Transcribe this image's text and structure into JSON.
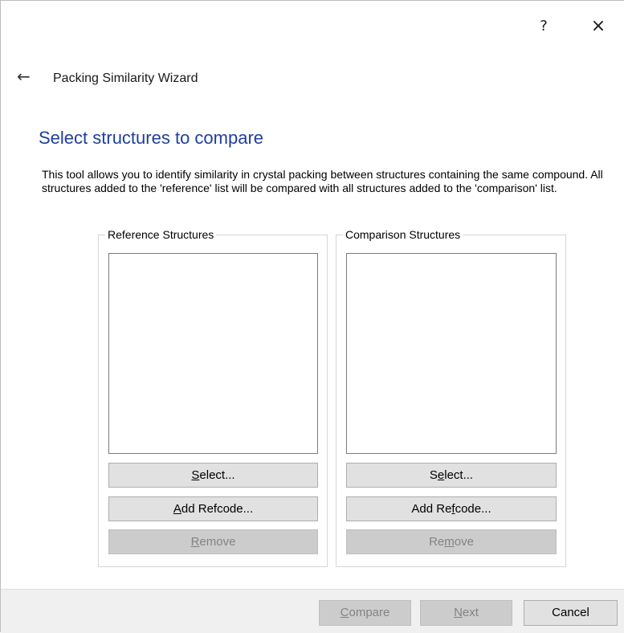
{
  "titlebar": {
    "help_label": "?",
    "close_label": "×",
    "icons": {
      "help": "question-mark-icon",
      "close": "close-icon"
    }
  },
  "header": {
    "back_icon": "←",
    "window_title": "Packing Similarity Wizard"
  },
  "page": {
    "heading": "Select structures to compare",
    "description": "This tool allows you to identify similarity in crystal packing between structures containing the same compound. All structures added to the 'reference' list will be compared with all structures added to the 'comparison' list."
  },
  "reference": {
    "title": "Reference Structures",
    "items": [],
    "select": {
      "before": "",
      "key": "S",
      "after": "elect..."
    },
    "add_refcode": {
      "before": "",
      "key": "A",
      "after": "dd Refcode..."
    },
    "remove": {
      "before": "",
      "key": "R",
      "after": "emove"
    }
  },
  "comparison": {
    "title": "Comparison Structures",
    "items": [],
    "select": {
      "before": "S",
      "key": "e",
      "after": "lect..."
    },
    "add_refcode": {
      "before": "Add Re",
      "key": "f",
      "after": "code..."
    },
    "remove": {
      "before": "Re",
      "key": "m",
      "after": "ove"
    }
  },
  "footer": {
    "compare": {
      "before": "",
      "key": "C",
      "after": "ompare"
    },
    "next": {
      "before": "",
      "key": "N",
      "after": "ext"
    },
    "cancel": "Cancel"
  },
  "colors": {
    "heading": "#1f3f9e",
    "button_face": "#e1e1e1",
    "button_disabled": "#cccccc",
    "footer_bg": "#f0f0f0"
  }
}
